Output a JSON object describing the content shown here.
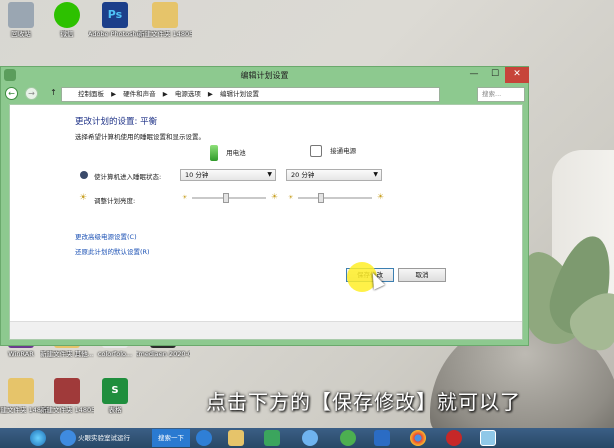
{
  "desktop": {
    "icons": [
      {
        "label": "回收站",
        "color": "#9aa6b2"
      },
      {
        "label": "微信",
        "color": "#2dc100"
      },
      {
        "label": "Adobe Photosho...",
        "color": "#1c3f8a"
      },
      {
        "label": "新建文件夹 14805的...",
        "color": "#e6c46a"
      },
      {
        "label": "WinRAR",
        "color": "#6b3b8f"
      },
      {
        "label": "新建文件夹 其他...",
        "color": "#e6c46a"
      },
      {
        "label": "colorfolo...",
        "color": "#e7e7e7"
      },
      {
        "label": "tmediaen 2020-02...",
        "color": "#2b2b2b"
      },
      {
        "label": "新建文件夹 14805的...",
        "color": "#e6c46a"
      },
      {
        "label": "新建文件夹 14805的...",
        "color": "#a03a3a"
      },
      {
        "label": "表格",
        "color": "#1f8e3d"
      }
    ]
  },
  "window": {
    "title": "编辑计划设置",
    "buttons": {
      "minimize": "—",
      "maximize": "☐",
      "close": "✕"
    },
    "nav": {
      "back": "←",
      "forward": "→",
      "up": "↑"
    },
    "breadcrumb": [
      "控制面板",
      "▶",
      "硬件和声音",
      "▶",
      "电源选项",
      "▶",
      "编辑计划设置"
    ],
    "search_placeholder": "搜索...",
    "heading": "更改计划的设置: 平衡",
    "subtext": "选择希望计算机使用的睡眠设置和显示设置。",
    "columns": {
      "battery": "用电池",
      "plugged": "接通电源"
    },
    "sleep": {
      "label": "使计算机进入睡眠状态:",
      "battery_value": "10 分钟",
      "plugged_value": "20 分钟"
    },
    "brightness": {
      "label": "调整计划亮度:",
      "battery_level": 0.45,
      "plugged_level": 0.3
    },
    "links": {
      "advanced": "更改高级电源设置(C)",
      "restore": "还原此计划的默认设置(R)"
    },
    "save_button": "保存修改",
    "cancel_button": "取消"
  },
  "caption": "点击下方的【保存修改】就可以了",
  "taskbar": {
    "items": [
      "火眼实验室试运行",
      "搜索一下"
    ]
  }
}
